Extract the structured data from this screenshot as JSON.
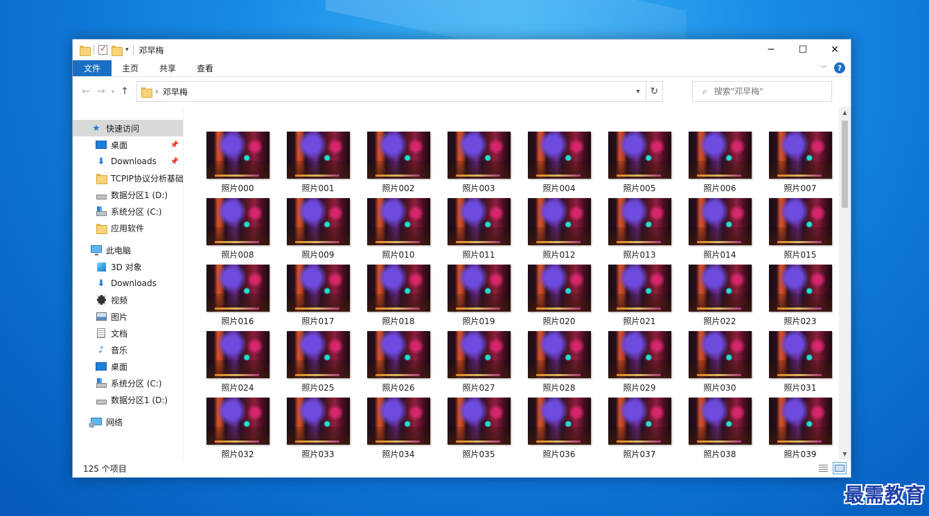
{
  "window": {
    "title": "邓早梅"
  },
  "ribbon": {
    "tabs": [
      {
        "label": "文件"
      },
      {
        "label": "主页"
      },
      {
        "label": "共享"
      },
      {
        "label": "查看"
      }
    ]
  },
  "address": {
    "current_folder": "邓早梅"
  },
  "search": {
    "placeholder": "搜索\"邓早梅\""
  },
  "sidebar": {
    "quick_access": {
      "label": "快速访问",
      "items": [
        {
          "label": "桌面",
          "icon": "desktop-icon",
          "pinned": true
        },
        {
          "label": "Downloads",
          "icon": "download-icon",
          "pinned": true
        },
        {
          "label": "TCPIP协议分析基础",
          "icon": "folder-icon",
          "pinned": false
        },
        {
          "label": "数据分区1 (D:)",
          "icon": "drive-icon",
          "pinned": false
        },
        {
          "label": "系统分区 (C:)",
          "icon": "system-drive-icon",
          "pinned": false
        },
        {
          "label": "应用软件",
          "icon": "folder-icon",
          "pinned": false
        }
      ]
    },
    "this_pc": {
      "label": "此电脑",
      "items": [
        {
          "label": "3D 对象",
          "icon": "3d-objects-icon"
        },
        {
          "label": "Downloads",
          "icon": "download-icon"
        },
        {
          "label": "视频",
          "icon": "video-icon"
        },
        {
          "label": "图片",
          "icon": "pictures-icon"
        },
        {
          "label": "文档",
          "icon": "documents-icon"
        },
        {
          "label": "音乐",
          "icon": "music-icon"
        },
        {
          "label": "桌面",
          "icon": "desktop-icon"
        },
        {
          "label": "系统分区 (C:)",
          "icon": "system-drive-icon"
        },
        {
          "label": "数据分区1 (D:)",
          "icon": "drive-icon"
        }
      ]
    },
    "network": {
      "label": "网络"
    }
  },
  "files": [
    "照片000",
    "照片001",
    "照片002",
    "照片003",
    "照片004",
    "照片005",
    "照片006",
    "照片007",
    "照片008",
    "照片009",
    "照片010",
    "照片011",
    "照片012",
    "照片013",
    "照片014",
    "照片015",
    "照片016",
    "照片017",
    "照片018",
    "照片019",
    "照片020",
    "照片021",
    "照片022",
    "照片023",
    "照片024",
    "照片025",
    "照片026",
    "照片027",
    "照片028",
    "照片029",
    "照片030",
    "照片031",
    "照片032",
    "照片033",
    "照片034",
    "照片035",
    "照片036",
    "照片037",
    "照片038",
    "照片039"
  ],
  "status": {
    "item_count": "125 个项目"
  },
  "watermark": "最需教育",
  "colors": {
    "accent": "#1a6fc4",
    "selection": "#d9d9d9"
  }
}
